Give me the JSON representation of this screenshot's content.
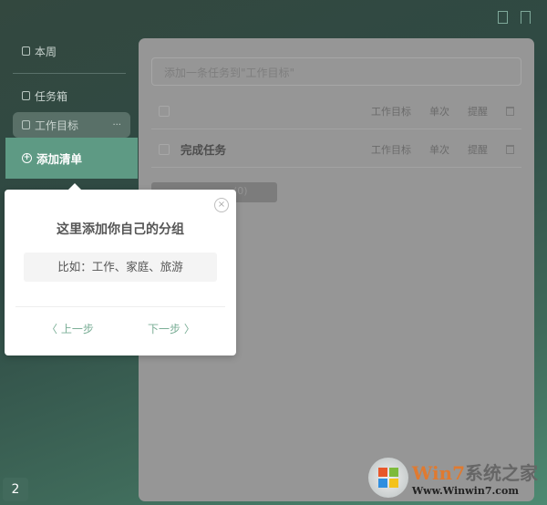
{
  "sidebar": {
    "items": [
      {
        "label": "本周"
      },
      {
        "label": "任务箱"
      },
      {
        "label": "工作目标",
        "more": "···"
      }
    ],
    "add_list": "添加清单"
  },
  "main": {
    "input_placeholder": "添加一条任务到\"工作目标\"",
    "tasks": [
      {
        "title": "",
        "list": "工作目标",
        "repeat": "单次",
        "remind": "提醒"
      },
      {
        "title": "完成任务",
        "list": "工作目标",
        "repeat": "单次",
        "remind": "提醒"
      }
    ],
    "done_button": "(0)"
  },
  "popup": {
    "close": "×",
    "title": "这里添加你自己的分组",
    "example": "比如：工作、家庭、旅游",
    "prev": "〈 上一步",
    "next": "下一步 〉"
  },
  "badge": "2",
  "watermark": {
    "brand_a": "Win7",
    "brand_b": "系统之家",
    "url": "Www.Winwin7.com"
  }
}
